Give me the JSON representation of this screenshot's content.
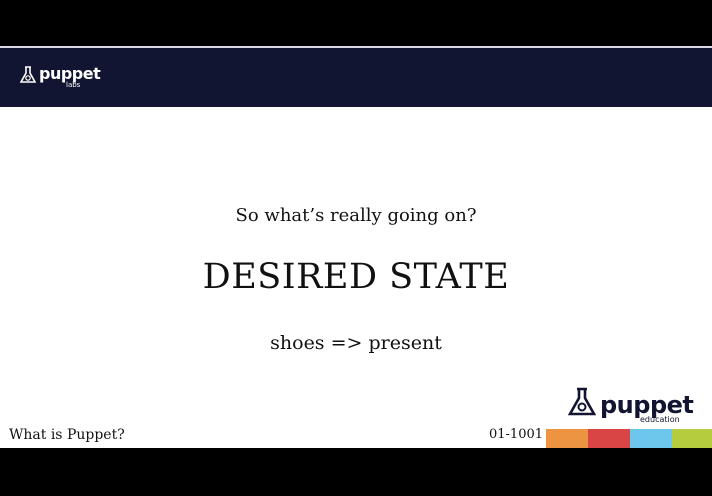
{
  "header": {
    "logo_word": "puppet",
    "logo_sub": "labs"
  },
  "slide": {
    "subtitle": "So what’s really going on?",
    "title": "DESIRED STATE",
    "code": "shoes => present",
    "footer_title": "What is Puppet?",
    "footer_number": "01-1001"
  },
  "brand": {
    "logo_word": "puppet",
    "logo_sub": "education"
  },
  "colors": {
    "header_bg": "#121531",
    "stripes": [
      "#ec9441",
      "#d94545",
      "#6dc7ec",
      "#b5cc3e"
    ]
  }
}
